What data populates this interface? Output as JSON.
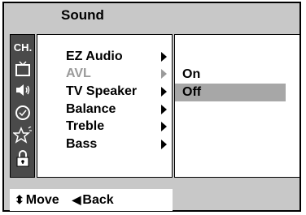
{
  "header": {
    "title": "Sound"
  },
  "sidebar": {
    "icons": [
      {
        "name": "channel-icon",
        "label": "CH."
      },
      {
        "name": "tv-picture-icon"
      },
      {
        "name": "speaker-sound-icon"
      },
      {
        "name": "clock-time-icon"
      },
      {
        "name": "star-special-icon"
      },
      {
        "name": "lock-icon"
      }
    ]
  },
  "menu": {
    "items": [
      {
        "label": "EZ Audio",
        "enabled": true
      },
      {
        "label": "AVL",
        "enabled": false
      },
      {
        "label": "TV Speaker",
        "enabled": true
      },
      {
        "label": "Balance",
        "enabled": true
      },
      {
        "label": "Treble",
        "enabled": true
      },
      {
        "label": "Bass",
        "enabled": true
      }
    ]
  },
  "submenu": {
    "options": [
      {
        "label": "On",
        "selected": false
      },
      {
        "label": "Off",
        "selected": true
      }
    ]
  },
  "footer": {
    "move_glyph": "⬍",
    "move_label": "Move",
    "back_glyph": "◀",
    "back_label": "Back"
  },
  "colors": {
    "frame": "#c8c8c8",
    "sidebar": "#4a4a4a",
    "selected": "#a7a7a7",
    "disabled": "#9a9a9a"
  }
}
